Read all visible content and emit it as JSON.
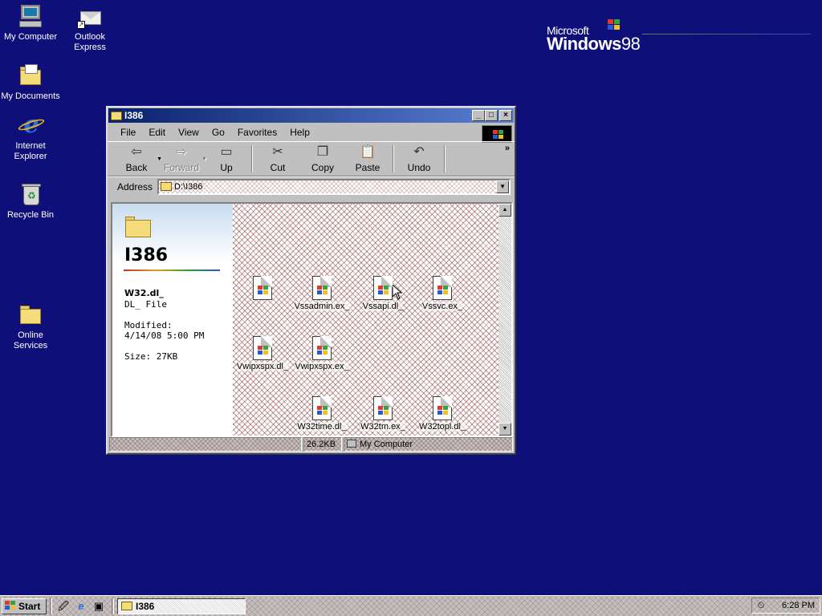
{
  "desktop": {
    "icons": [
      {
        "label": "My Computer",
        "icon": "my-computer-icon"
      },
      {
        "label": "Outlook Express",
        "icon": "outlook-express-icon"
      },
      {
        "label": "My Documents",
        "icon": "my-documents-icon"
      },
      {
        "label": "Internet Explorer",
        "icon": "internet-explorer-icon"
      },
      {
        "label": "Recycle Bin",
        "icon": "recycle-bin-icon"
      },
      {
        "label": "Online Services",
        "icon": "folder-icon"
      }
    ],
    "logo": {
      "brand": "Microsoft",
      "product": "Windows",
      "version": "98"
    }
  },
  "window": {
    "title": "I386",
    "menu": [
      "File",
      "Edit",
      "View",
      "Go",
      "Favorites",
      "Help"
    ],
    "toolbar": [
      {
        "label": "Back",
        "icon": "back-arrow-icon",
        "enabled": true
      },
      {
        "label": "Forward",
        "icon": "forward-arrow-icon",
        "enabled": false
      },
      {
        "label": "Up",
        "icon": "up-folder-icon",
        "enabled": true
      },
      {
        "label": "Cut",
        "icon": "scissors-icon",
        "enabled": true
      },
      {
        "label": "Copy",
        "icon": "copy-icon",
        "enabled": true
      },
      {
        "label": "Paste",
        "icon": "paste-icon",
        "enabled": true
      },
      {
        "label": "Undo",
        "icon": "undo-icon",
        "enabled": true
      }
    ],
    "address": {
      "label": "Address",
      "value": "D:\\I386"
    },
    "left_pane": {
      "folder_title": "I386",
      "selected_name": "W32.dl_",
      "selected_type": "DL_ File",
      "modified_label": "Modified:",
      "modified_value": "4/14/08 5:00 PM",
      "size": "Size: 27KB"
    },
    "files": [
      {
        "name": ""
      },
      {
        "name": "Vssadmin.ex_"
      },
      {
        "name": "Vssapi.dl_"
      },
      {
        "name": "Vssvc.ex_"
      },
      {
        "name": "Vwipxspx.dl_"
      },
      {
        "name": "Vwipxspx.ex_"
      },
      {
        "name": "W32time.dl_"
      },
      {
        "name": "W32tm.ex_"
      },
      {
        "name": "W32topl.dl_"
      }
    ],
    "status": {
      "size": "26.2KB",
      "zone": "My Computer"
    }
  },
  "taskbar": {
    "start_label": "Start",
    "quick_launch": [
      "desktop-icon",
      "internet-explorer-icon",
      "channels-icon"
    ],
    "task_button": "I386",
    "clock": "6:28 PM"
  },
  "colors": {
    "desktop": "#0f0f7a",
    "titlebar_start": "#08216b",
    "titlebar_end": "#5b7fd4"
  }
}
